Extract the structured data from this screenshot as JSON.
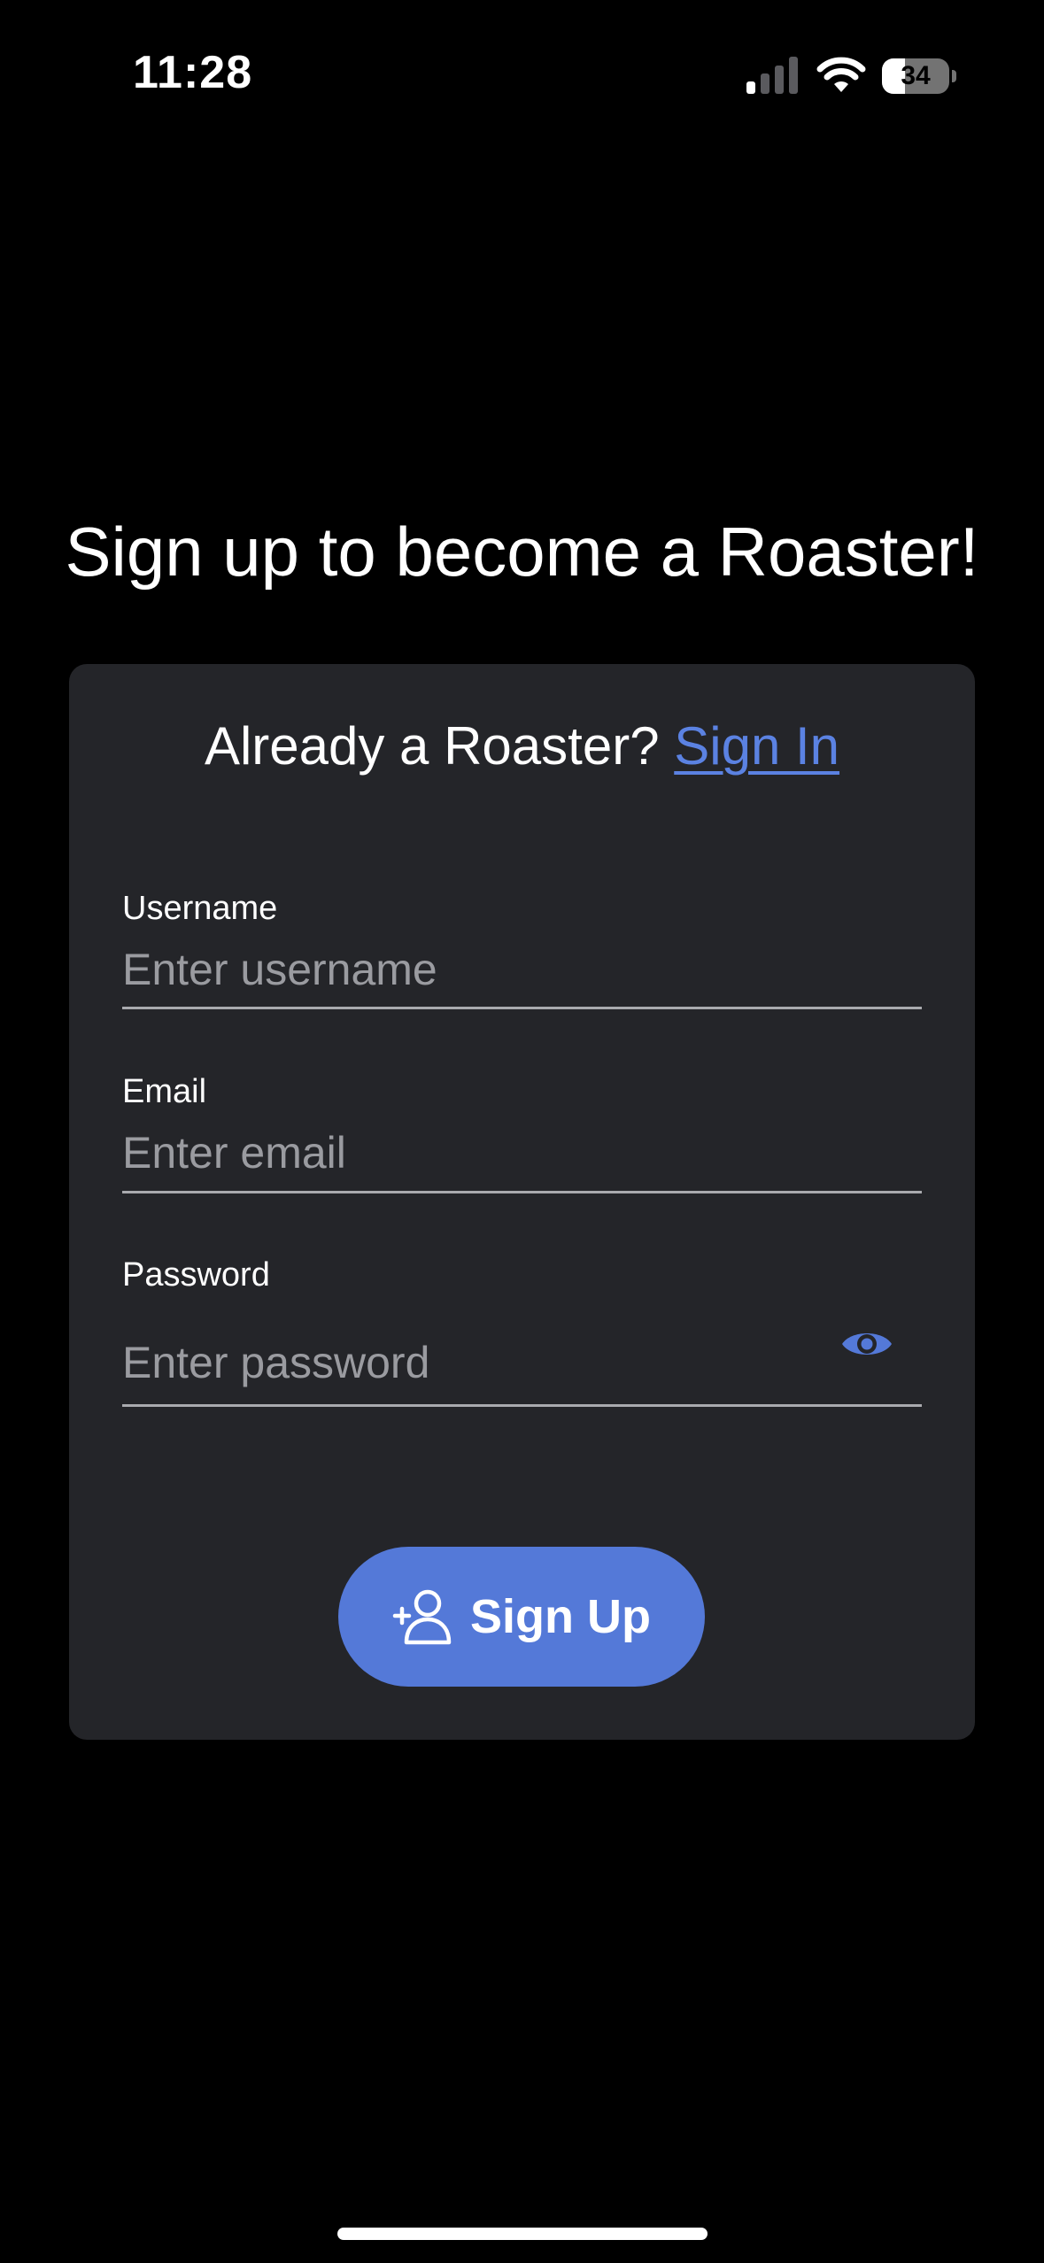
{
  "status_bar": {
    "time": "11:28",
    "battery_level": 34,
    "battery_text": "34",
    "signal_bars_active": 1,
    "signal_bars_total": 4,
    "icons": [
      "signal-icon",
      "wifi-icon",
      "battery-icon"
    ]
  },
  "page": {
    "heading": "Sign up to become a Roaster!"
  },
  "card": {
    "prompt_text": "Already a Roaster?",
    "signin_link_label": "Sign In",
    "fields": {
      "username": {
        "label": "Username",
        "placeholder": "Enter username",
        "value": ""
      },
      "email": {
        "label": "Email",
        "placeholder": "Enter email",
        "value": ""
      },
      "password": {
        "label": "Password",
        "placeholder": "Enter password",
        "value": "",
        "toggle_icon": "eye-icon"
      }
    },
    "signup_button": {
      "label": "Sign Up",
      "icon": "add-user-icon"
    }
  },
  "colors": {
    "background": "#000000",
    "card": "#242529",
    "accent": "#5479d8",
    "link": "#5b82e2",
    "placeholder": "#9a9ba0",
    "underline": "#a9aaae"
  }
}
